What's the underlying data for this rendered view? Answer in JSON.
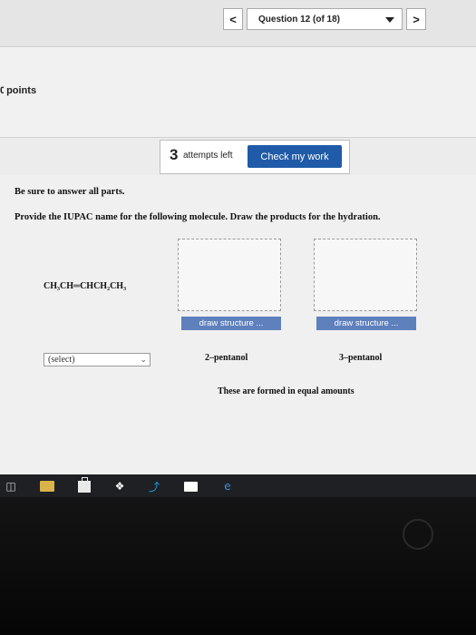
{
  "navigation": {
    "prev_label": "<",
    "next_label": ">",
    "question_selector": "Question 12 (of 18)"
  },
  "points": {
    "label": "points"
  },
  "attempts": {
    "count": "3",
    "label": "attempts left",
    "check_button": "Check my work"
  },
  "question": {
    "instruction_1": "Be sure to answer all parts.",
    "instruction_2": "Provide the IUPAC name for the following molecule. Draw the products for the hydration.",
    "molecule": "CH₃CH═CHCH₂CH₃",
    "name_select": "(select)",
    "draw_button_1": "draw structure ...",
    "draw_button_2": "draw structure ...",
    "product_1": "2–pentanol",
    "product_2": "3–pentanol",
    "note": "These are formed in equal amounts"
  },
  "taskbar": {
    "icons": [
      "task-view-icon",
      "file-explorer-icon",
      "store-icon",
      "dropbox-icon",
      "bolt-icon",
      "mail-icon",
      "edge-icon"
    ]
  },
  "colors": {
    "accent_blue": "#1f5ba8",
    "draw_button_blue": "#5e80bd"
  }
}
